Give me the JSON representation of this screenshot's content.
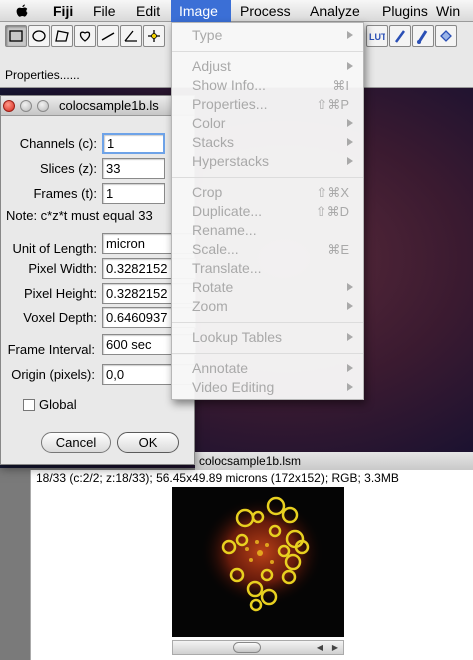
{
  "menubar": {
    "app": "Fiji",
    "items": [
      "File",
      "Edit",
      "Image",
      "Process",
      "Analyze",
      "Plugins",
      "Win"
    ],
    "active": "Image"
  },
  "toolbar": {
    "properties_label": "Properties......",
    "lut_label": "LUT"
  },
  "image_menu": {
    "items": [
      {
        "label": "Type",
        "shortcut": "",
        "submenu": true
      },
      {
        "label": "Adjust",
        "shortcut": "",
        "submenu": true
      },
      {
        "label": "Show Info...",
        "shortcut": "⌘I",
        "submenu": false
      },
      {
        "label": "Properties...",
        "shortcut": "⇧⌘P",
        "submenu": false
      },
      {
        "label": "Color",
        "shortcut": "",
        "submenu": true
      },
      {
        "label": "Stacks",
        "shortcut": "",
        "submenu": true
      },
      {
        "label": "Hyperstacks",
        "shortcut": "",
        "submenu": true
      },
      {
        "label": "Crop",
        "shortcut": "⇧⌘X",
        "submenu": false
      },
      {
        "label": "Duplicate...",
        "shortcut": "⇧⌘D",
        "submenu": false
      },
      {
        "label": "Rename...",
        "shortcut": "",
        "submenu": false
      },
      {
        "label": "Scale...",
        "shortcut": "⌘E",
        "submenu": false
      },
      {
        "label": "Translate...",
        "shortcut": "",
        "submenu": false
      },
      {
        "label": "Rotate",
        "shortcut": "",
        "submenu": true
      },
      {
        "label": "Zoom",
        "shortcut": "",
        "submenu": true
      },
      {
        "label": "Lookup Tables",
        "shortcut": "",
        "submenu": true
      },
      {
        "label": "Annotate",
        "shortcut": "",
        "submenu": true
      },
      {
        "label": "Video Editing",
        "shortcut": "",
        "submenu": true
      }
    ]
  },
  "dialog": {
    "title": "colocsample1b.ls",
    "channels_label": "Channels (c):",
    "channels_value": "1",
    "slices_label": "Slices (z):",
    "slices_value": "33",
    "frames_label": "Frames (t):",
    "frames_value": "1",
    "note": "Note: c*z*t must equal 33",
    "unit_label": "Unit of Length:",
    "unit_value": "micron",
    "pixel_width_label": "Pixel Width:",
    "pixel_width_value": "0.3282152",
    "pixel_height_label": "Pixel Height:",
    "pixel_height_value": "0.3282152",
    "voxel_depth_label": "Voxel Depth:",
    "voxel_depth_value": "0.6460937",
    "frame_interval_label": "Frame Interval:",
    "frame_interval_value": "600 sec",
    "origin_label": "Origin (pixels):",
    "origin_value": "0,0",
    "global_label": "Global",
    "global_checked": false,
    "cancel_label": "Cancel",
    "ok_label": "OK"
  },
  "image_window": {
    "title": "colocsample1b.lsm"
  },
  "second_window": {
    "info": "18/33 (c:2/2; z:18/33); 56.45x49.89 microns (172x152); RGB; 3.3MB"
  },
  "colors": {
    "menu_highlight": "#3b6fd6",
    "disabled_text": "#a9a9a9",
    "focus_ring": "#6ea3e8"
  }
}
